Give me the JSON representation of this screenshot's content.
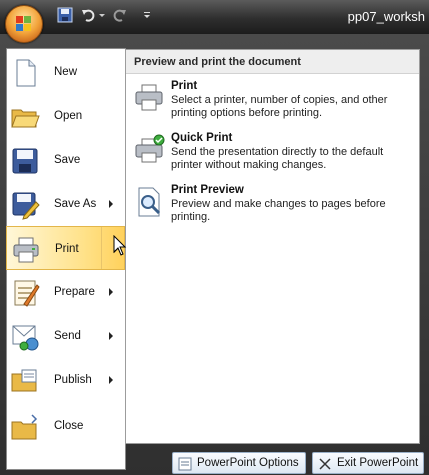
{
  "titlebar": {
    "title": "pp07_worksh",
    "office_button_icon": "office-logo-icon",
    "quick_access": [
      "save-icon",
      "undo-icon",
      "redo-icon",
      "customize-dropdown-icon"
    ]
  },
  "menu": {
    "items": [
      {
        "label": "New",
        "icon": "new-document-icon",
        "has_submenu": false
      },
      {
        "label": "Open",
        "icon": "open-folder-icon",
        "has_submenu": false
      },
      {
        "label": "Save",
        "icon": "save-disk-icon",
        "has_submenu": false
      },
      {
        "label": "Save As",
        "icon": "save-as-icon",
        "has_submenu": true
      },
      {
        "label": "Print",
        "icon": "printer-icon",
        "has_submenu": true,
        "selected": true
      },
      {
        "label": "Prepare",
        "icon": "prepare-icon",
        "has_submenu": true
      },
      {
        "label": "Send",
        "icon": "send-icon",
        "has_submenu": true
      },
      {
        "label": "Publish",
        "icon": "publish-icon",
        "has_submenu": true
      },
      {
        "label": "Close",
        "icon": "close-folder-icon",
        "has_submenu": false
      }
    ]
  },
  "submenu": {
    "header": "Preview and print the document",
    "items": [
      {
        "name": "Print",
        "description": "Select a printer, number of copies, and other printing options before printing.",
        "icon": "printer-icon"
      },
      {
        "name": "Quick Print",
        "description": "Send the presentation directly to the default printer without making changes.",
        "icon": "quick-print-icon"
      },
      {
        "name": "Print Preview",
        "description": "Preview and make changes to pages before printing.",
        "icon": "print-preview-icon"
      }
    ]
  },
  "footer": {
    "options_label": "PowerPoint Options",
    "exit_label": "Exit PowerPoint"
  },
  "colors": {
    "selected_item": "#ffd15c",
    "frame": "#2f2f2f"
  }
}
